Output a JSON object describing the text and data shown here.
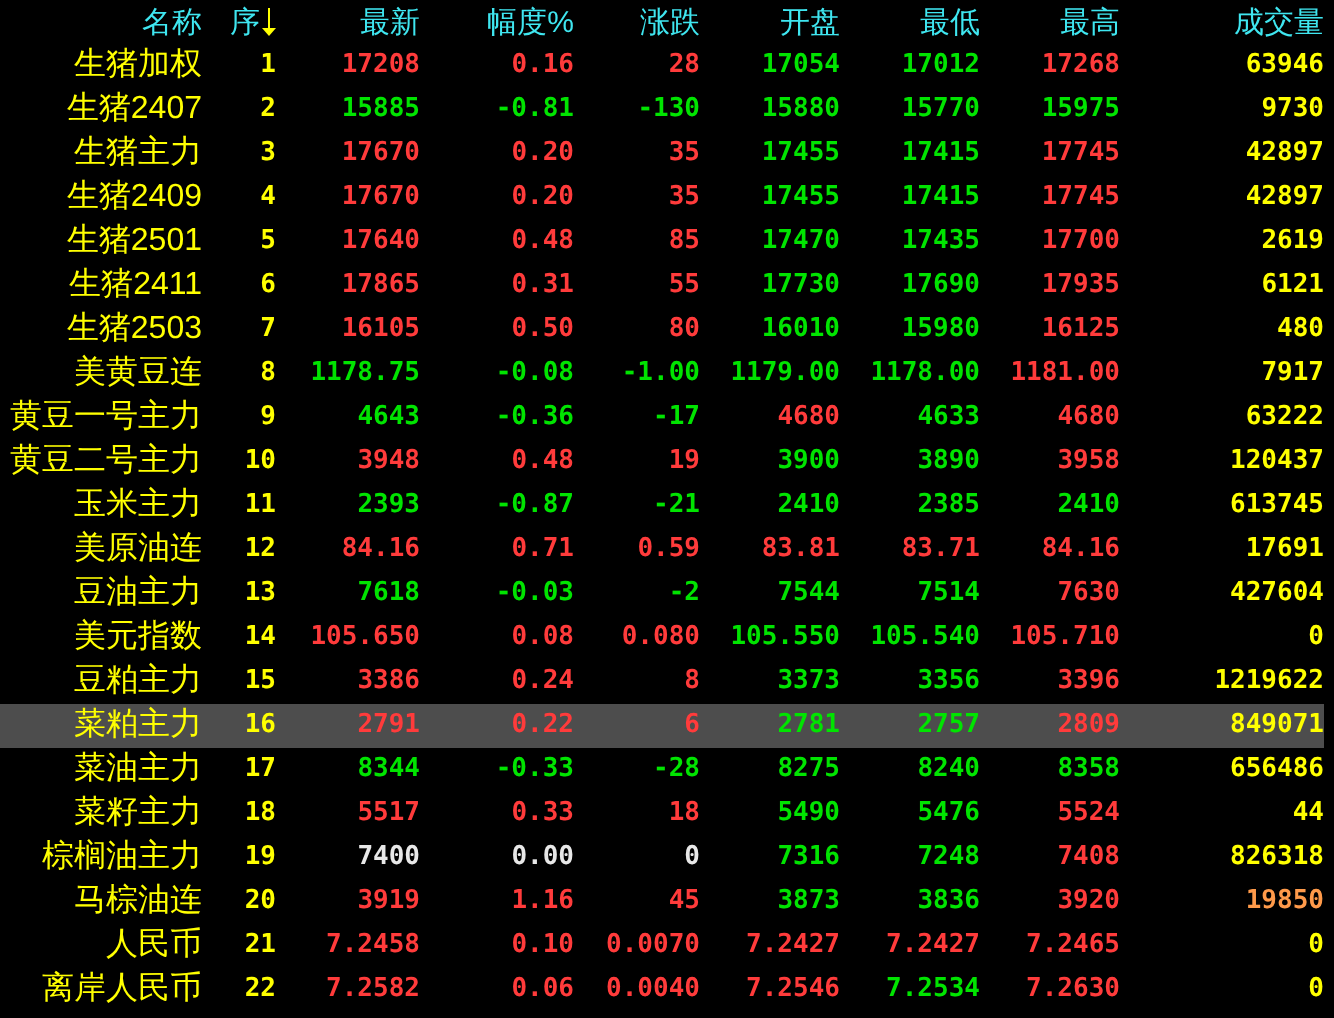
{
  "columns": [
    {
      "label": "名称",
      "sorted": false
    },
    {
      "label": "序",
      "sorted": true
    },
    {
      "label": "最新",
      "sorted": false
    },
    {
      "label": "幅度%",
      "sorted": false
    },
    {
      "label": "涨跌",
      "sorted": false
    },
    {
      "label": "开盘",
      "sorted": false
    },
    {
      "label": "最低",
      "sorted": false
    },
    {
      "label": "最高",
      "sorted": false
    },
    {
      "label": "成交量",
      "sorted": false
    }
  ],
  "rows": [
    {
      "name": "生猪加权",
      "seq": "1",
      "selected": false,
      "cells": [
        {
          "text": "17208",
          "color": "#ff3b3b"
        },
        {
          "text": "0.16",
          "color": "#ff3b3b"
        },
        {
          "text": "28",
          "color": "#ff3b3b"
        },
        {
          "text": "17054",
          "color": "#00e400"
        },
        {
          "text": "17012",
          "color": "#00e400"
        },
        {
          "text": "17268",
          "color": "#ff3b3b"
        }
      ],
      "volume": {
        "text": "63946",
        "color": "#ffff00"
      }
    },
    {
      "name": "生猪2407",
      "seq": "2",
      "selected": false,
      "cells": [
        {
          "text": "15885",
          "color": "#00e400"
        },
        {
          "text": "-0.81",
          "color": "#00e400"
        },
        {
          "text": "-130",
          "color": "#00e400"
        },
        {
          "text": "15880",
          "color": "#00e400"
        },
        {
          "text": "15770",
          "color": "#00e400"
        },
        {
          "text": "15975",
          "color": "#00e400"
        }
      ],
      "volume": {
        "text": "9730",
        "color": "#ffff00"
      }
    },
    {
      "name": "生猪主力",
      "seq": "3",
      "selected": false,
      "cells": [
        {
          "text": "17670",
          "color": "#ff3b3b"
        },
        {
          "text": "0.20",
          "color": "#ff3b3b"
        },
        {
          "text": "35",
          "color": "#ff3b3b"
        },
        {
          "text": "17455",
          "color": "#00e400"
        },
        {
          "text": "17415",
          "color": "#00e400"
        },
        {
          "text": "17745",
          "color": "#ff3b3b"
        }
      ],
      "volume": {
        "text": "42897",
        "color": "#ffff00"
      }
    },
    {
      "name": "生猪2409",
      "seq": "4",
      "selected": false,
      "cells": [
        {
          "text": "17670",
          "color": "#ff3b3b"
        },
        {
          "text": "0.20",
          "color": "#ff3b3b"
        },
        {
          "text": "35",
          "color": "#ff3b3b"
        },
        {
          "text": "17455",
          "color": "#00e400"
        },
        {
          "text": "17415",
          "color": "#00e400"
        },
        {
          "text": "17745",
          "color": "#ff3b3b"
        }
      ],
      "volume": {
        "text": "42897",
        "color": "#ffff00"
      }
    },
    {
      "name": "生猪2501",
      "seq": "5",
      "selected": false,
      "cells": [
        {
          "text": "17640",
          "color": "#ff3b3b"
        },
        {
          "text": "0.48",
          "color": "#ff3b3b"
        },
        {
          "text": "85",
          "color": "#ff3b3b"
        },
        {
          "text": "17470",
          "color": "#00e400"
        },
        {
          "text": "17435",
          "color": "#00e400"
        },
        {
          "text": "17700",
          "color": "#ff3b3b"
        }
      ],
      "volume": {
        "text": "2619",
        "color": "#ffff00"
      }
    },
    {
      "name": "生猪2411",
      "seq": "6",
      "selected": false,
      "cells": [
        {
          "text": "17865",
          "color": "#ff3b3b"
        },
        {
          "text": "0.31",
          "color": "#ff3b3b"
        },
        {
          "text": "55",
          "color": "#ff3b3b"
        },
        {
          "text": "17730",
          "color": "#00e400"
        },
        {
          "text": "17690",
          "color": "#00e400"
        },
        {
          "text": "17935",
          "color": "#ff3b3b"
        }
      ],
      "volume": {
        "text": "6121",
        "color": "#ffff00"
      }
    },
    {
      "name": "生猪2503",
      "seq": "7",
      "selected": false,
      "cells": [
        {
          "text": "16105",
          "color": "#ff3b3b"
        },
        {
          "text": "0.50",
          "color": "#ff3b3b"
        },
        {
          "text": "80",
          "color": "#ff3b3b"
        },
        {
          "text": "16010",
          "color": "#00e400"
        },
        {
          "text": "15980",
          "color": "#00e400"
        },
        {
          "text": "16125",
          "color": "#ff3b3b"
        }
      ],
      "volume": {
        "text": "480",
        "color": "#ffff00"
      }
    },
    {
      "name": "美黄豆连",
      "seq": "8",
      "selected": false,
      "cells": [
        {
          "text": "1178.75",
          "color": "#00e400"
        },
        {
          "text": "-0.08",
          "color": "#00e400"
        },
        {
          "text": "-1.00",
          "color": "#00e400"
        },
        {
          "text": "1179.00",
          "color": "#00e400"
        },
        {
          "text": "1178.00",
          "color": "#00e400"
        },
        {
          "text": "1181.00",
          "color": "#ff3b3b"
        }
      ],
      "volume": {
        "text": "7917",
        "color": "#ffff00"
      }
    },
    {
      "name": "黄豆一号主力",
      "seq": "9",
      "selected": false,
      "cells": [
        {
          "text": "4643",
          "color": "#00e400"
        },
        {
          "text": "-0.36",
          "color": "#00e400"
        },
        {
          "text": "-17",
          "color": "#00e400"
        },
        {
          "text": "4680",
          "color": "#ff3b3b"
        },
        {
          "text": "4633",
          "color": "#00e400"
        },
        {
          "text": "4680",
          "color": "#ff3b3b"
        }
      ],
      "volume": {
        "text": "63222",
        "color": "#ffff00"
      }
    },
    {
      "name": "黄豆二号主力",
      "seq": "10",
      "selected": false,
      "cells": [
        {
          "text": "3948",
          "color": "#ff3b3b"
        },
        {
          "text": "0.48",
          "color": "#ff3b3b"
        },
        {
          "text": "19",
          "color": "#ff3b3b"
        },
        {
          "text": "3900",
          "color": "#00e400"
        },
        {
          "text": "3890",
          "color": "#00e400"
        },
        {
          "text": "3958",
          "color": "#ff3b3b"
        }
      ],
      "volume": {
        "text": "120437",
        "color": "#ffff00"
      }
    },
    {
      "name": "玉米主力",
      "seq": "11",
      "selected": false,
      "cells": [
        {
          "text": "2393",
          "color": "#00e400"
        },
        {
          "text": "-0.87",
          "color": "#00e400"
        },
        {
          "text": "-21",
          "color": "#00e400"
        },
        {
          "text": "2410",
          "color": "#00e400"
        },
        {
          "text": "2385",
          "color": "#00e400"
        },
        {
          "text": "2410",
          "color": "#00e400"
        }
      ],
      "volume": {
        "text": "613745",
        "color": "#ffff00"
      }
    },
    {
      "name": "美原油连",
      "seq": "12",
      "selected": false,
      "cells": [
        {
          "text": "84.16",
          "color": "#ff3b3b"
        },
        {
          "text": "0.71",
          "color": "#ff3b3b"
        },
        {
          "text": "0.59",
          "color": "#ff3b3b"
        },
        {
          "text": "83.81",
          "color": "#ff3b3b"
        },
        {
          "text": "83.71",
          "color": "#ff3b3b"
        },
        {
          "text": "84.16",
          "color": "#ff3b3b"
        }
      ],
      "volume": {
        "text": "17691",
        "color": "#ffff00"
      }
    },
    {
      "name": "豆油主力",
      "seq": "13",
      "selected": false,
      "cells": [
        {
          "text": "7618",
          "color": "#00e400"
        },
        {
          "text": "-0.03",
          "color": "#00e400"
        },
        {
          "text": "-2",
          "color": "#00e400"
        },
        {
          "text": "7544",
          "color": "#00e400"
        },
        {
          "text": "7514",
          "color": "#00e400"
        },
        {
          "text": "7630",
          "color": "#ff3b3b"
        }
      ],
      "volume": {
        "text": "427604",
        "color": "#ffff00"
      }
    },
    {
      "name": "美元指数",
      "seq": "14",
      "selected": false,
      "cells": [
        {
          "text": "105.650",
          "color": "#ff3b3b"
        },
        {
          "text": "0.08",
          "color": "#ff3b3b"
        },
        {
          "text": "0.080",
          "color": "#ff3b3b"
        },
        {
          "text": "105.550",
          "color": "#00e400"
        },
        {
          "text": "105.540",
          "color": "#00e400"
        },
        {
          "text": "105.710",
          "color": "#ff3b3b"
        }
      ],
      "volume": {
        "text": "0",
        "color": "#ffff00"
      }
    },
    {
      "name": "豆粕主力",
      "seq": "15",
      "selected": false,
      "cells": [
        {
          "text": "3386",
          "color": "#ff3b3b"
        },
        {
          "text": "0.24",
          "color": "#ff3b3b"
        },
        {
          "text": "8",
          "color": "#ff3b3b"
        },
        {
          "text": "3373",
          "color": "#00e400"
        },
        {
          "text": "3356",
          "color": "#00e400"
        },
        {
          "text": "3396",
          "color": "#ff3b3b"
        }
      ],
      "volume": {
        "text": "1219622",
        "color": "#ffff00"
      }
    },
    {
      "name": "菜粕主力",
      "seq": "16",
      "selected": true,
      "cells": [
        {
          "text": "2791",
          "color": "#ff3b3b"
        },
        {
          "text": "0.22",
          "color": "#ff3b3b"
        },
        {
          "text": "6",
          "color": "#ff3b3b"
        },
        {
          "text": "2781",
          "color": "#00e400"
        },
        {
          "text": "2757",
          "color": "#00e400"
        },
        {
          "text": "2809",
          "color": "#ff3b3b"
        }
      ],
      "volume": {
        "text": "849071",
        "color": "#ffff00"
      }
    },
    {
      "name": "菜油主力",
      "seq": "17",
      "selected": false,
      "cells": [
        {
          "text": "8344",
          "color": "#00e400"
        },
        {
          "text": "-0.33",
          "color": "#00e400"
        },
        {
          "text": "-28",
          "color": "#00e400"
        },
        {
          "text": "8275",
          "color": "#00e400"
        },
        {
          "text": "8240",
          "color": "#00e400"
        },
        {
          "text": "8358",
          "color": "#00e400"
        }
      ],
      "volume": {
        "text": "656486",
        "color": "#ffff00"
      }
    },
    {
      "name": "菜籽主力",
      "seq": "18",
      "selected": false,
      "cells": [
        {
          "text": "5517",
          "color": "#ff3b3b"
        },
        {
          "text": "0.33",
          "color": "#ff3b3b"
        },
        {
          "text": "18",
          "color": "#ff3b3b"
        },
        {
          "text": "5490",
          "color": "#00e400"
        },
        {
          "text": "5476",
          "color": "#00e400"
        },
        {
          "text": "5524",
          "color": "#ff3b3b"
        }
      ],
      "volume": {
        "text": "44",
        "color": "#ffff00"
      }
    },
    {
      "name": "棕榈油主力",
      "seq": "19",
      "selected": false,
      "cells": [
        {
          "text": "7400",
          "color": "#e8e8e8"
        },
        {
          "text": "0.00",
          "color": "#e8e8e8"
        },
        {
          "text": "0",
          "color": "#e8e8e8"
        },
        {
          "text": "7316",
          "color": "#00e400"
        },
        {
          "text": "7248",
          "color": "#00e400"
        },
        {
          "text": "7408",
          "color": "#ff3b3b"
        }
      ],
      "volume": {
        "text": "826318",
        "color": "#ffff00"
      }
    },
    {
      "name": "马棕油连",
      "seq": "20",
      "selected": false,
      "cells": [
        {
          "text": "3919",
          "color": "#ff3b3b"
        },
        {
          "text": "1.16",
          "color": "#ff3b3b"
        },
        {
          "text": "45",
          "color": "#ff3b3b"
        },
        {
          "text": "3873",
          "color": "#00e400"
        },
        {
          "text": "3836",
          "color": "#00e400"
        },
        {
          "text": "3920",
          "color": "#ff3b3b"
        }
      ],
      "volume": {
        "text": "19850",
        "color": "#ff9a4a"
      }
    },
    {
      "name": "人民币",
      "seq": "21",
      "selected": false,
      "cells": [
        {
          "text": "7.2458",
          "color": "#ff3b3b"
        },
        {
          "text": "0.10",
          "color": "#ff3b3b"
        },
        {
          "text": "0.0070",
          "color": "#ff3b3b"
        },
        {
          "text": "7.2427",
          "color": "#ff3b3b"
        },
        {
          "text": "7.2427",
          "color": "#ff3b3b"
        },
        {
          "text": "7.2465",
          "color": "#ff3b3b"
        }
      ],
      "volume": {
        "text": "0",
        "color": "#ffff00"
      }
    },
    {
      "name": "离岸人民币",
      "seq": "22",
      "selected": false,
      "cells": [
        {
          "text": "7.2582",
          "color": "#ff3b3b"
        },
        {
          "text": "0.06",
          "color": "#ff3b3b"
        },
        {
          "text": "0.0040",
          "color": "#ff3b3b"
        },
        {
          "text": "7.2546",
          "color": "#ff3b3b"
        },
        {
          "text": "7.2534",
          "color": "#00e400"
        },
        {
          "text": "7.2630",
          "color": "#ff3b3b"
        }
      ],
      "volume": {
        "text": "0",
        "color": "#ffff00"
      }
    }
  ]
}
